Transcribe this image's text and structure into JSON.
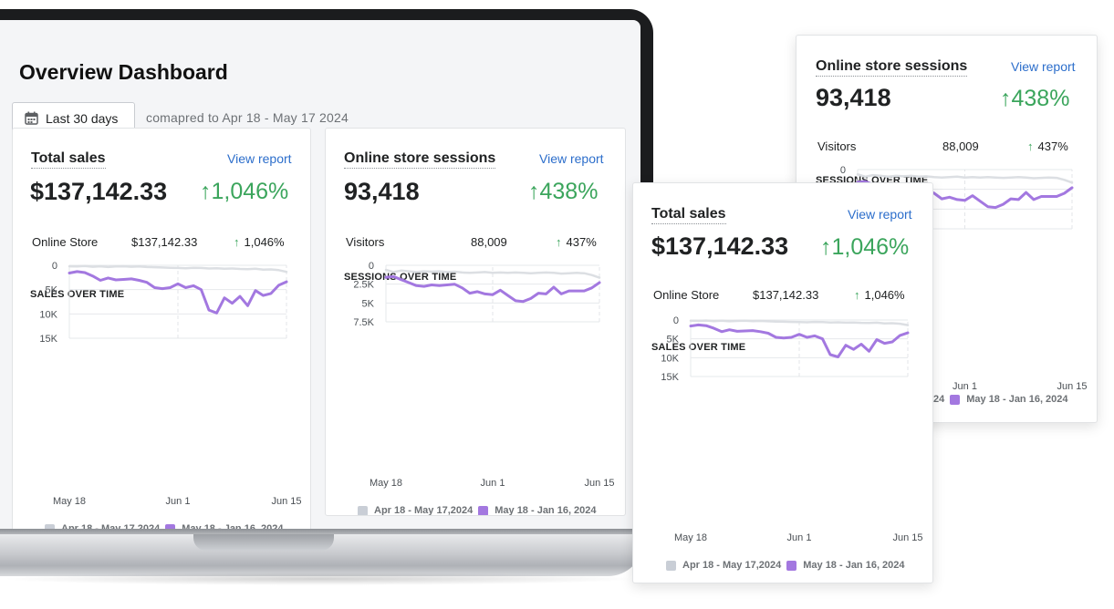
{
  "dashboard": {
    "title": "Overview Dashboard",
    "date_button": "Last 30 days",
    "compared_text": "comapred to Apr 18 - May 17 2024"
  },
  "sales_card": {
    "title": "Total sales",
    "view_report": "View report",
    "total": "$137,142.33",
    "change": "1,046%",
    "breakdown": {
      "label": "Online Store",
      "value": "$137,142.33",
      "change": "1,046%"
    },
    "section_title": "SALES OVER TIME",
    "y_ticks": [
      "15K",
      "10K",
      "5K",
      "0"
    ],
    "x_ticks": [
      "May 18",
      "Jun 1",
      "Jun 15"
    ]
  },
  "sessions_card": {
    "title": "Online store sessions",
    "view_report": "View report",
    "total": "93,418",
    "change": "438%",
    "breakdown": {
      "label": "Visitors",
      "value": "88,009",
      "change": "437%"
    },
    "section_title": "SESSIONS OVER TIME",
    "y_ticks": [
      "7.5K",
      "5K",
      "2.5K",
      "0"
    ],
    "x_ticks": [
      "May 18",
      "Jun 1",
      "Jun 15"
    ]
  },
  "legend": {
    "previous_sales": "Apr 18 - May 17,2024",
    "previous_sessions": "Apr 18 - May 17,2024",
    "current": "May 18 - Jan 16, 2024"
  },
  "colors": {
    "current": "#a378e0",
    "previous": "#dcdfe3",
    "positive": "#3ba55c",
    "link": "#2c6ecb"
  },
  "icons": {
    "calendar": "calendar-icon",
    "up": "arrow-up-icon"
  },
  "chart_data": [
    {
      "type": "line",
      "title": "SALES OVER TIME",
      "x_ticks": [
        "May 18",
        "Jun 1",
        "Jun 15"
      ],
      "ylim": [
        0,
        15000
      ],
      "series": [
        {
          "name": "May 18 - Jan 16, 2024",
          "values": [
            1600,
            1300,
            1500,
            2200,
            3100,
            2600,
            3000,
            2900,
            2800,
            3100,
            3500,
            4600,
            4800,
            4600,
            3800,
            4600,
            4200,
            5000,
            9200,
            9800,
            6700,
            7800,
            6400,
            8300,
            5200,
            6200,
            5800,
            4100,
            3400
          ]
        },
        {
          "name": "Apr 18 - May 17,2024",
          "values": [
            200,
            250,
            150,
            300,
            200,
            350,
            250,
            200,
            300,
            250,
            350,
            400,
            450,
            500,
            550,
            600,
            500,
            550,
            650,
            600,
            700,
            650,
            750,
            800,
            700,
            900,
            850,
            1000,
            1350
          ]
        }
      ]
    },
    {
      "type": "line",
      "title": "SESSIONS OVER TIME",
      "x_ticks": [
        "May 18",
        "Jun 1",
        "Jun 15"
      ],
      "ylim": [
        0,
        7500
      ],
      "series": [
        {
          "name": "May 18 - Jan 16, 2024",
          "values": [
            1600,
            1500,
            1900,
            2300,
            2700,
            2800,
            2600,
            2700,
            2600,
            2500,
            3000,
            3700,
            3500,
            3800,
            3900,
            3300,
            4000,
            4700,
            4800,
            4400,
            3700,
            3800,
            2900,
            3800,
            3400,
            3400,
            3400,
            3000,
            2300
          ]
        },
        {
          "name": "Apr 18 - May 17,2024",
          "values": [
            600,
            900,
            700,
            800,
            900,
            800,
            850,
            800,
            900,
            850,
            950,
            1000,
            950,
            900,
            1000,
            950,
            1000,
            950,
            1000,
            1050,
            1000,
            950,
            1000,
            1100,
            1050,
            1000,
            1050,
            1300,
            1650
          ]
        }
      ]
    }
  ]
}
